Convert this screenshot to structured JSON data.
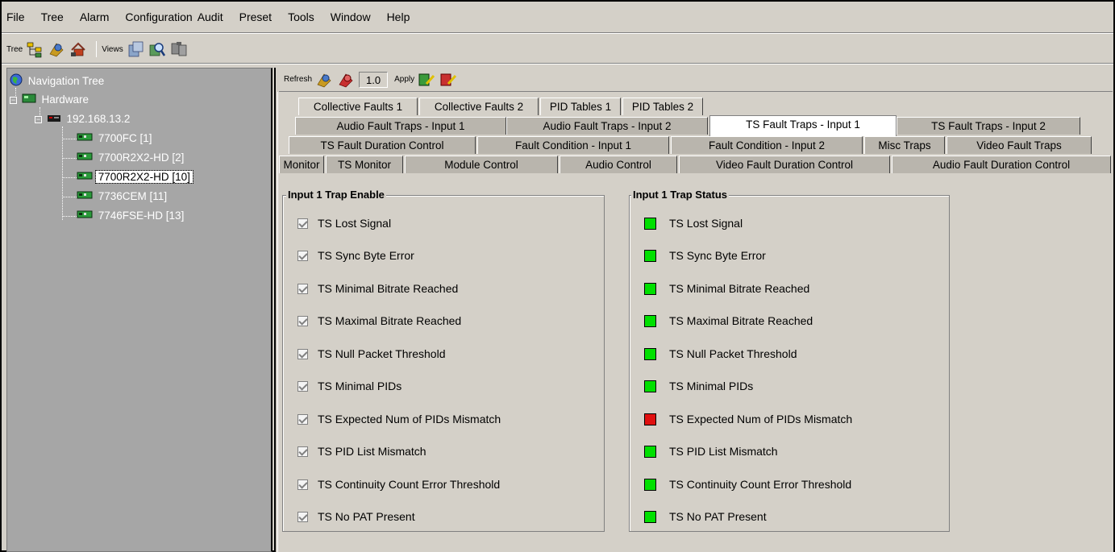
{
  "menu": [
    {
      "label": "File"
    },
    {
      "label": "Tree"
    },
    {
      "label": "Alarm"
    },
    {
      "label": "Configuration"
    },
    {
      "label": "Audit"
    },
    {
      "label": "Preset"
    },
    {
      "label": "Tools"
    },
    {
      "label": "Window"
    },
    {
      "label": "Help"
    }
  ],
  "toolbar": {
    "tree_label": "Tree",
    "views_label": "Views",
    "icons": [
      "tree-structure-icon",
      "tree-config-icon",
      "tree-home-icon",
      "views-doc-icon",
      "views-search-icon",
      "views-copy-icon"
    ]
  },
  "nav": {
    "title": "Navigation Tree",
    "hardware": "Hardware",
    "host": "192.168.13.2",
    "cards": [
      "7700FC  [1]",
      "7700R2X2-HD  [2]",
      "7700R2X2-HD  [10]",
      "7736CEM  [11]",
      "7746FSE-HD  [13]"
    ],
    "selected_index": 2
  },
  "content_toolbar": {
    "refresh_label": "Refresh",
    "interval_value": "1.0",
    "apply_label": "Apply"
  },
  "tabs": {
    "row1": [
      "Collective Faults 1",
      "Collective Faults 2",
      "PID Tables 1",
      "PID Tables 2"
    ],
    "row2": [
      "Audio Fault Traps - Input 1",
      "Audio Fault Traps - Input 2",
      "TS Fault Traps - Input 1",
      "TS Fault Traps - Input 2"
    ],
    "row3": [
      "TS Fault Duration Control",
      "Fault Condition - Input 1",
      "Fault Condition - Input 2",
      "Misc Traps",
      "Video Fault Traps"
    ],
    "row4": [
      "Monitor",
      "TS Monitor",
      "Module Control",
      "Audio Control",
      "Video Fault Duration Control",
      "Audio Fault Duration Control"
    ],
    "active": "TS Fault Traps - Input 1"
  },
  "trap_enable": {
    "title": "Input 1 Trap Enable",
    "items": [
      {
        "label": "TS Lost Signal",
        "checked": true
      },
      {
        "label": "TS Sync Byte Error",
        "checked": true
      },
      {
        "label": "TS Minimal Bitrate Reached",
        "checked": true
      },
      {
        "label": "TS Maximal Bitrate Reached",
        "checked": true
      },
      {
        "label": "TS Null Packet Threshold",
        "checked": true
      },
      {
        "label": "TS Minimal PIDs",
        "checked": true
      },
      {
        "label": "TS Expected Num of PIDs Mismatch",
        "checked": true
      },
      {
        "label": "TS PID List Mismatch",
        "checked": true
      },
      {
        "label": "TS Continuity Count Error Threshold",
        "checked": true
      },
      {
        "label": "TS No PAT Present",
        "checked": true
      }
    ]
  },
  "trap_status": {
    "title": "Input 1 Trap Status",
    "colors": {
      "ok": "#00e000",
      "fault": "#e01010"
    },
    "items": [
      {
        "label": "TS Lost Signal",
        "status": "ok"
      },
      {
        "label": "TS Sync Byte Error",
        "status": "ok"
      },
      {
        "label": "TS Minimal Bitrate Reached",
        "status": "ok"
      },
      {
        "label": "TS Maximal Bitrate Reached",
        "status": "ok"
      },
      {
        "label": "TS Null Packet Threshold",
        "status": "ok"
      },
      {
        "label": "TS Minimal PIDs",
        "status": "ok"
      },
      {
        "label": "TS Expected Num of PIDs Mismatch",
        "status": "fault"
      },
      {
        "label": "TS PID List Mismatch",
        "status": "ok"
      },
      {
        "label": "TS Continuity Count Error Threshold",
        "status": "ok"
      },
      {
        "label": "TS No PAT Present",
        "status": "ok"
      }
    ]
  }
}
